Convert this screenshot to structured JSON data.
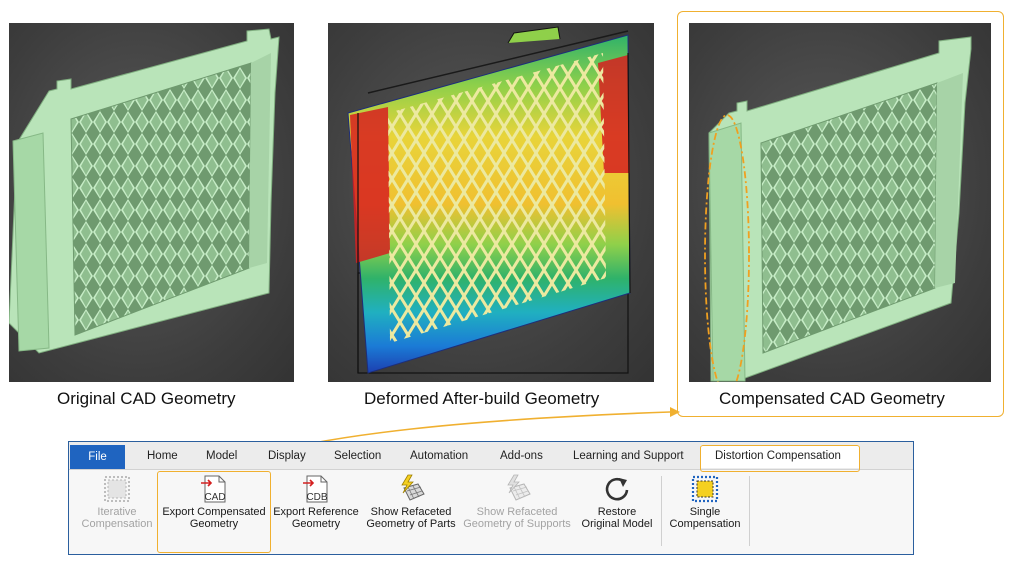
{
  "captions": {
    "original": "Original CAD Geometry",
    "deformed": "Deformed After-build Geometry",
    "compensated": "Compensated CAD Geometry"
  },
  "colors": {
    "highlight": "#f0b030",
    "file_tab": "#1f64c0",
    "part_green": "#a8d8a8",
    "viewport_bg": "#3d3d3d"
  },
  "ribbon": {
    "tabs": [
      "File",
      "Home",
      "Model",
      "Display",
      "Selection",
      "Automation",
      "Add-ons",
      "Learning and Support",
      "Distortion Compensation"
    ],
    "selected_tab": "Distortion Compensation",
    "commands": [
      {
        "line1": "Iterative",
        "line2": "Compensation",
        "icon": "iterative-compensation-icon",
        "enabled": false
      },
      {
        "line1": "Export Compensated",
        "line2": "Geometry",
        "icon": "export-cad-icon",
        "icon_text": "CAD",
        "enabled": true
      },
      {
        "line1": "Export Reference",
        "line2": "Geometry",
        "icon": "export-cdb-icon",
        "icon_text": "CDB",
        "enabled": true
      },
      {
        "line1": "Show Refaceted",
        "line2": "Geometry of Parts",
        "icon": "refaceted-parts-icon",
        "enabled": true
      },
      {
        "line1": "Show Refaceted",
        "line2": "Geometry of Supports",
        "icon": "refaceted-supports-icon",
        "enabled": false
      },
      {
        "line1": "Restore",
        "line2": "Original Model",
        "icon": "restore-icon",
        "enabled": true
      },
      {
        "line1": "Single",
        "line2": "Compensation",
        "icon": "single-compensation-icon",
        "enabled": true
      }
    ]
  }
}
